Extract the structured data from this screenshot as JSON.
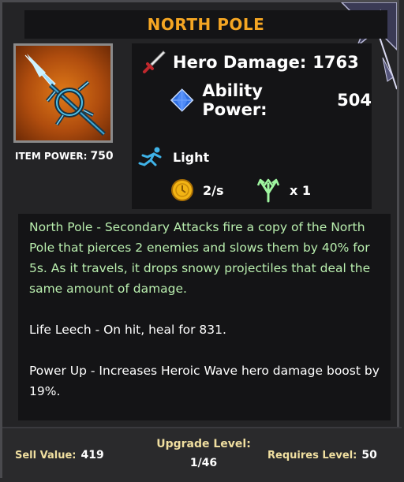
{
  "item": {
    "name": "NORTH POLE",
    "power_label": "ITEM POWER:",
    "power_value": "750",
    "image_icon": "ice-spear-icon"
  },
  "stats": {
    "hero_damage": {
      "label": "Hero Damage:",
      "value": "1763",
      "icon": "sword-icon"
    },
    "ability_power": {
      "label": "Ability Power:",
      "value": "504",
      "icon": "blue-gem-icon"
    },
    "speed": {
      "label": "Light",
      "icon": "runner-icon"
    },
    "attack_rate": {
      "value": "2/s",
      "icon": "gold-coin-icon"
    },
    "projectiles": {
      "value": "x 1",
      "icon": "trident-arrows-icon"
    }
  },
  "description": {
    "primary": "North Pole - Secondary Attacks fire a copy of the North Pole that pierces 2 enemies and slows them by 40% for 5s. As it travels, it drops snowy projectiles that deal the same amount of damage.",
    "secondary": [
      "Life Leech - On hit, heal for 831.",
      "Power Up - Increases Heroic Wave hero damage boost by 19%."
    ]
  },
  "footer": {
    "sell_label": "Sell Value:",
    "sell_value": "419",
    "upgrade_label": "Upgrade Level:",
    "upgrade_value": "1/46",
    "requires_label": "Requires Level:",
    "requires_value": "50"
  },
  "colors": {
    "title": "#f5a623",
    "flavor_text": "#b9eeae",
    "footer_label": "#f0dfa0"
  }
}
